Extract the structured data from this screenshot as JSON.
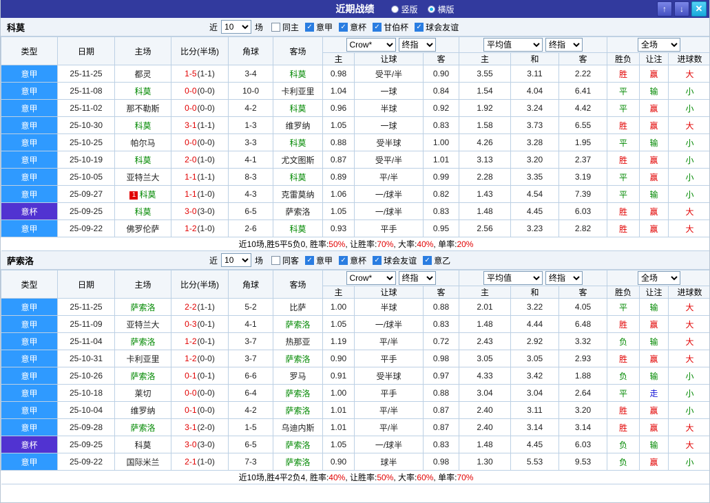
{
  "titlebar": {
    "title": "近期战绩",
    "radios": [
      {
        "label": "竖版",
        "selected": false
      },
      {
        "label": "横版",
        "selected": true
      }
    ],
    "buttons": {
      "up": "↑",
      "down": "↓",
      "close": "✕"
    }
  },
  "filter_labels": {
    "near": "近",
    "games": "场"
  },
  "table_header": {
    "type": "类型",
    "date": "日期",
    "home": "主场",
    "score": "比分(半场)",
    "corners": "角球",
    "away": "客场",
    "ah_home": "主",
    "ah_line": "让球",
    "ah_away": "客",
    "eu_home": "主",
    "eu_draw": "和",
    "eu_away": "客",
    "res_wl": "胜负",
    "res_ah": "让注",
    "res_ou": "进球数",
    "selects": {
      "bookmaker": "Crow*",
      "final_ah": "终指",
      "average": "平均值",
      "final_eu": "终指",
      "full": "全场"
    }
  },
  "colors": {
    "type_bg": {
      "意甲": "#2f9aff",
      "意杯": "#5133d1"
    },
    "result": {
      "胜": "#e10000",
      "平": "#008800",
      "负": "#008800",
      "赢": "#e10000",
      "输": "#008800",
      "走": "#1616d6",
      "大": "#e10000",
      "小": "#008800"
    },
    "focal_team": "#008800",
    "score": "#e10000"
  },
  "sections": [
    {
      "team": "科莫",
      "count": "10",
      "same_label": "同主",
      "same_checked": false,
      "competitions": [
        {
          "label": "意甲",
          "checked": true
        },
        {
          "label": "意杯",
          "checked": true
        },
        {
          "label": "甘伯杯",
          "checked": true
        },
        {
          "label": "球会友谊",
          "checked": true
        }
      ],
      "rows": [
        {
          "type": "意甲",
          "date": "25-11-25",
          "home": "都灵",
          "home_rc": "",
          "home_focal": false,
          "score": "1-5",
          "half": "1-1",
          "corners": "3-4",
          "away": "科莫",
          "away_rc": "",
          "away_focal": true,
          "ah_home": "0.98",
          "ah_line": "受平/半",
          "ah_away": "0.90",
          "eu_home": "3.55",
          "eu_draw": "3.11",
          "eu_away": "2.22",
          "res_wl": "胜",
          "res_ah": "赢",
          "res_ou": "大"
        },
        {
          "type": "意甲",
          "date": "25-11-08",
          "home": "科莫",
          "home_rc": "",
          "home_focal": true,
          "score": "0-0",
          "half": "0-0",
          "corners": "10-0",
          "away": "卡利亚里",
          "away_rc": "",
          "away_focal": false,
          "ah_home": "1.04",
          "ah_line": "一球",
          "ah_away": "0.84",
          "eu_home": "1.54",
          "eu_draw": "4.04",
          "eu_away": "6.41",
          "res_wl": "平",
          "res_ah": "输",
          "res_ou": "小"
        },
        {
          "type": "意甲",
          "date": "25-11-02",
          "home": "那不勒斯",
          "home_rc": "",
          "home_focal": false,
          "score": "0-0",
          "half": "0-0",
          "corners": "4-2",
          "away": "科莫",
          "away_rc": "",
          "away_focal": true,
          "ah_home": "0.96",
          "ah_line": "半球",
          "ah_away": "0.92",
          "eu_home": "1.92",
          "eu_draw": "3.24",
          "eu_away": "4.42",
          "res_wl": "平",
          "res_ah": "赢",
          "res_ou": "小"
        },
        {
          "type": "意甲",
          "date": "25-10-30",
          "home": "科莫",
          "home_rc": "",
          "home_focal": true,
          "score": "3-1",
          "half": "1-1",
          "corners": "1-3",
          "away": "维罗纳",
          "away_rc": "",
          "away_focal": false,
          "ah_home": "1.05",
          "ah_line": "一球",
          "ah_away": "0.83",
          "eu_home": "1.58",
          "eu_draw": "3.73",
          "eu_away": "6.55",
          "res_wl": "胜",
          "res_ah": "赢",
          "res_ou": "大"
        },
        {
          "type": "意甲",
          "date": "25-10-25",
          "home": "帕尔马",
          "home_rc": "",
          "home_focal": false,
          "score": "0-0",
          "half": "0-0",
          "corners": "3-3",
          "away": "科莫",
          "away_rc": "",
          "away_focal": true,
          "ah_home": "0.88",
          "ah_line": "受半球",
          "ah_away": "1.00",
          "eu_home": "4.26",
          "eu_draw": "3.28",
          "eu_away": "1.95",
          "res_wl": "平",
          "res_ah": "输",
          "res_ou": "小"
        },
        {
          "type": "意甲",
          "date": "25-10-19",
          "home": "科莫",
          "home_rc": "",
          "home_focal": true,
          "score": "2-0",
          "half": "1-0",
          "corners": "4-1",
          "away": "尤文图斯",
          "away_rc": "",
          "away_focal": false,
          "ah_home": "0.87",
          "ah_line": "受平/半",
          "ah_away": "1.01",
          "eu_home": "3.13",
          "eu_draw": "3.20",
          "eu_away": "2.37",
          "res_wl": "胜",
          "res_ah": "赢",
          "res_ou": "小"
        },
        {
          "type": "意甲",
          "date": "25-10-05",
          "home": "亚特兰大",
          "home_rc": "",
          "home_focal": false,
          "score": "1-1",
          "half": "1-1",
          "corners": "8-3",
          "away": "科莫",
          "away_rc": "",
          "away_focal": true,
          "ah_home": "0.89",
          "ah_line": "平/半",
          "ah_away": "0.99",
          "eu_home": "2.28",
          "eu_draw": "3.35",
          "eu_away": "3.19",
          "res_wl": "平",
          "res_ah": "赢",
          "res_ou": "小"
        },
        {
          "type": "意甲",
          "date": "25-09-27",
          "home": "科莫",
          "home_rc": "1",
          "home_focal": true,
          "score": "1-1",
          "half": "1-0",
          "corners": "4-3",
          "away": "克雷莫纳",
          "away_rc": "",
          "away_focal": false,
          "ah_home": "1.06",
          "ah_line": "一/球半",
          "ah_away": "0.82",
          "eu_home": "1.43",
          "eu_draw": "4.54",
          "eu_away": "7.39",
          "res_wl": "平",
          "res_ah": "输",
          "res_ou": "小"
        },
        {
          "type": "意杯",
          "date": "25-09-25",
          "home": "科莫",
          "home_rc": "",
          "home_focal": true,
          "score": "3-0",
          "half": "3-0",
          "corners": "6-5",
          "away": "萨索洛",
          "away_rc": "",
          "away_focal": false,
          "ah_home": "1.05",
          "ah_line": "一/球半",
          "ah_away": "0.83",
          "eu_home": "1.48",
          "eu_draw": "4.45",
          "eu_away": "6.03",
          "res_wl": "胜",
          "res_ah": "赢",
          "res_ou": "大"
        },
        {
          "type": "意甲",
          "date": "25-09-22",
          "home": "佛罗伦萨",
          "home_rc": "",
          "home_focal": false,
          "score": "1-2",
          "half": "1-0",
          "corners": "2-6",
          "away": "科莫",
          "away_rc": "",
          "away_focal": true,
          "ah_home": "0.93",
          "ah_line": "平手",
          "ah_away": "0.95",
          "eu_home": "2.56",
          "eu_draw": "3.23",
          "eu_away": "2.82",
          "res_wl": "胜",
          "res_ah": "赢",
          "res_ou": "大"
        }
      ],
      "summary": {
        "prefix": "近10场,胜5平5负0,",
        "stats": [
          {
            "label": "胜率:",
            "value": "50%"
          },
          {
            "label": "让胜率:",
            "value": "70%"
          },
          {
            "label": "大率:",
            "value": "40%"
          },
          {
            "label": "单率:",
            "value": "20%"
          }
        ]
      }
    },
    {
      "team": "萨索洛",
      "count": "10",
      "same_label": "同客",
      "same_checked": false,
      "competitions": [
        {
          "label": "意甲",
          "checked": true
        },
        {
          "label": "意杯",
          "checked": true
        },
        {
          "label": "球会友谊",
          "checked": true
        },
        {
          "label": "意乙",
          "checked": true
        }
      ],
      "rows": [
        {
          "type": "意甲",
          "date": "25-11-25",
          "home": "萨索洛",
          "home_rc": "",
          "home_focal": true,
          "score": "2-2",
          "half": "1-1",
          "corners": "5-2",
          "away": "比萨",
          "away_rc": "",
          "away_focal": false,
          "ah_home": "1.00",
          "ah_line": "半球",
          "ah_away": "0.88",
          "eu_home": "2.01",
          "eu_draw": "3.22",
          "eu_away": "4.05",
          "res_wl": "平",
          "res_ah": "输",
          "res_ou": "大"
        },
        {
          "type": "意甲",
          "date": "25-11-09",
          "home": "亚特兰大",
          "home_rc": "",
          "home_focal": false,
          "score": "0-3",
          "half": "0-1",
          "corners": "4-1",
          "away": "萨索洛",
          "away_rc": "",
          "away_focal": true,
          "ah_home": "1.05",
          "ah_line": "一/球半",
          "ah_away": "0.83",
          "eu_home": "1.48",
          "eu_draw": "4.44",
          "eu_away": "6.48",
          "res_wl": "胜",
          "res_ah": "赢",
          "res_ou": "大"
        },
        {
          "type": "意甲",
          "date": "25-11-04",
          "home": "萨索洛",
          "home_rc": "",
          "home_focal": true,
          "score": "1-2",
          "half": "0-1",
          "corners": "3-7",
          "away": "热那亚",
          "away_rc": "",
          "away_focal": false,
          "ah_home": "1.19",
          "ah_line": "平/半",
          "ah_away": "0.72",
          "eu_home": "2.43",
          "eu_draw": "2.92",
          "eu_away": "3.32",
          "res_wl": "负",
          "res_ah": "输",
          "res_ou": "大"
        },
        {
          "type": "意甲",
          "date": "25-10-31",
          "home": "卡利亚里",
          "home_rc": "",
          "home_focal": false,
          "score": "1-2",
          "half": "0-0",
          "corners": "3-7",
          "away": "萨索洛",
          "away_rc": "",
          "away_focal": true,
          "ah_home": "0.90",
          "ah_line": "平手",
          "ah_away": "0.98",
          "eu_home": "3.05",
          "eu_draw": "3.05",
          "eu_away": "2.93",
          "res_wl": "胜",
          "res_ah": "赢",
          "res_ou": "大"
        },
        {
          "type": "意甲",
          "date": "25-10-26",
          "home": "萨索洛",
          "home_rc": "",
          "home_focal": true,
          "score": "0-1",
          "half": "0-1",
          "corners": "6-6",
          "away": "罗马",
          "away_rc": "",
          "away_focal": false,
          "ah_home": "0.91",
          "ah_line": "受半球",
          "ah_away": "0.97",
          "eu_home": "4.33",
          "eu_draw": "3.42",
          "eu_away": "1.88",
          "res_wl": "负",
          "res_ah": "输",
          "res_ou": "小"
        },
        {
          "type": "意甲",
          "date": "25-10-18",
          "home": "莱切",
          "home_rc": "",
          "home_focal": false,
          "score": "0-0",
          "half": "0-0",
          "corners": "6-4",
          "away": "萨索洛",
          "away_rc": "",
          "away_focal": true,
          "ah_home": "1.00",
          "ah_line": "平手",
          "ah_away": "0.88",
          "eu_home": "3.04",
          "eu_draw": "3.04",
          "eu_away": "2.64",
          "res_wl": "平",
          "res_ah": "走",
          "res_ou": "小"
        },
        {
          "type": "意甲",
          "date": "25-10-04",
          "home": "维罗纳",
          "home_rc": "",
          "home_focal": false,
          "score": "0-1",
          "half": "0-0",
          "corners": "4-2",
          "away": "萨索洛",
          "away_rc": "",
          "away_focal": true,
          "ah_home": "1.01",
          "ah_line": "平/半",
          "ah_away": "0.87",
          "eu_home": "2.40",
          "eu_draw": "3.11",
          "eu_away": "3.20",
          "res_wl": "胜",
          "res_ah": "赢",
          "res_ou": "小"
        },
        {
          "type": "意甲",
          "date": "25-09-28",
          "home": "萨索洛",
          "home_rc": "",
          "home_focal": true,
          "score": "3-1",
          "half": "2-0",
          "corners": "1-5",
          "away": "乌迪内斯",
          "away_rc": "",
          "away_focal": false,
          "ah_home": "1.01",
          "ah_line": "平/半",
          "ah_away": "0.87",
          "eu_home": "2.40",
          "eu_draw": "3.14",
          "eu_away": "3.14",
          "res_wl": "胜",
          "res_ah": "赢",
          "res_ou": "大"
        },
        {
          "type": "意杯",
          "date": "25-09-25",
          "home": "科莫",
          "home_rc": "",
          "home_focal": false,
          "score": "3-0",
          "half": "3-0",
          "corners": "6-5",
          "away": "萨索洛",
          "away_rc": "",
          "away_focal": true,
          "ah_home": "1.05",
          "ah_line": "一/球半",
          "ah_away": "0.83",
          "eu_home": "1.48",
          "eu_draw": "4.45",
          "eu_away": "6.03",
          "res_wl": "负",
          "res_ah": "输",
          "res_ou": "大"
        },
        {
          "type": "意甲",
          "date": "25-09-22",
          "home": "国际米兰",
          "home_rc": "",
          "home_focal": false,
          "score": "2-1",
          "half": "1-0",
          "corners": "7-3",
          "away": "萨索洛",
          "away_rc": "",
          "away_focal": true,
          "ah_home": "0.90",
          "ah_line": "球半",
          "ah_away": "0.98",
          "eu_home": "1.30",
          "eu_draw": "5.53",
          "eu_away": "9.53",
          "res_wl": "负",
          "res_ah": "赢",
          "res_ou": "小"
        }
      ],
      "summary": {
        "prefix": "近10场,胜4平2负4,",
        "stats": [
          {
            "label": "胜率:",
            "value": "40%"
          },
          {
            "label": "让胜率:",
            "value": "50%"
          },
          {
            "label": "大率:",
            "value": "60%"
          },
          {
            "label": "单率:",
            "value": "70%"
          }
        ]
      }
    }
  ]
}
